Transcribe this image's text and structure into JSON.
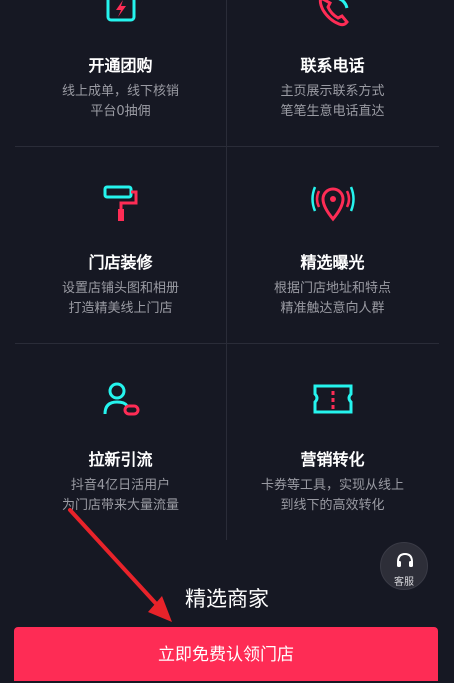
{
  "features": [
    {
      "title": "开通团购",
      "line1": "线上成单，线下核销",
      "line2": "平台0抽佣",
      "icon": "phone-charge-icon"
    },
    {
      "title": "联系电话",
      "line1": "主页展示联系方式",
      "line2": "笔笔生意电话直达",
      "icon": "phone-call-icon"
    },
    {
      "title": "门店装修",
      "line1": "设置店铺头图和相册",
      "line2": "打造精美线上门店",
      "icon": "paint-roller-icon"
    },
    {
      "title": "精选曝光",
      "line1": "根据门店地址和特点",
      "line2": "精准触达意向人群",
      "icon": "location-signal-icon"
    },
    {
      "title": "拉新引流",
      "line1": "抖音4亿日活用户",
      "line2": "为门店带来大量流量",
      "icon": "user-add-icon"
    },
    {
      "title": "营销转化",
      "line1": "卡券等工具，实现从线上",
      "line2": "到线下的高效转化",
      "icon": "coupon-ticket-icon"
    }
  ],
  "support": {
    "label": "客服",
    "icon": "headset-icon"
  },
  "section_title": "精选商家",
  "cta_label": "立即免费认领门店",
  "colors": {
    "background": "#161823",
    "accent_red": "#fe2c55",
    "accent_cyan": "#25f4ee"
  }
}
